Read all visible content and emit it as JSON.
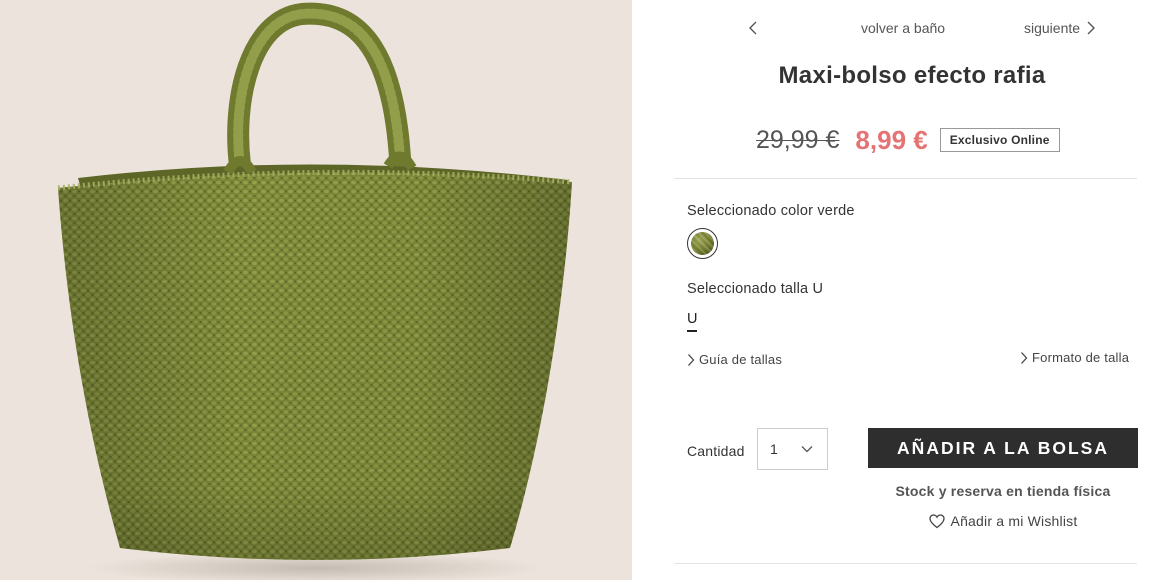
{
  "navigation": {
    "back_label": "volver a baño",
    "next_label": "siguiente"
  },
  "product": {
    "title": "Maxi-bolso efecto rafia",
    "old_price": "29,99 €",
    "new_price": "8,99 €",
    "badge": "Exclusivo Online",
    "image_icon": "woven-raffia-tote-bag"
  },
  "color": {
    "selected_label": "Seleccionado color verde",
    "swatch_icon": "green-raffia-swatch"
  },
  "size": {
    "selected_label": "Seleccionado talla U",
    "options": [
      "U"
    ],
    "guide_link": "Guía de tallas",
    "format_link": "Formato de talla"
  },
  "purchase": {
    "quantity_label": "Cantidad",
    "quantity_value": "1",
    "add_button": "AÑADIR A LA BOLSA",
    "stock_link": "Stock y reserva en tienda física",
    "wishlist_link": "Añadir a mi Wishlist"
  },
  "colors": {
    "sale_price": "#e57373",
    "button_bg": "#2e2e2e",
    "image_bg": "#ece4dc",
    "bag_green": "#7a8636"
  }
}
